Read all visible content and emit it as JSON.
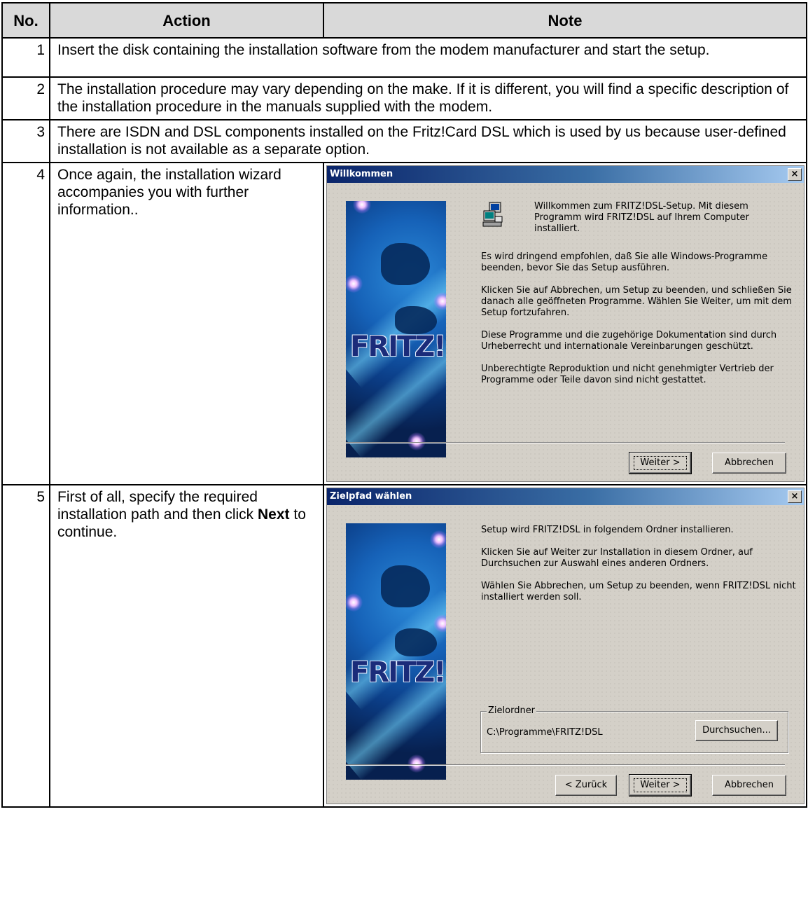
{
  "headers": {
    "no": "No.",
    "action": "Action",
    "note": "Note"
  },
  "rows": [
    {
      "no": "1",
      "text": "Insert the disk containing the installation software from the modem manufacturer and start the setup."
    },
    {
      "no": "2",
      "text": "The installation procedure may vary depending on the make. If it is different, you will find a specific description of the installation procedure in the manuals supplied with the modem."
    },
    {
      "no": "3",
      "text": "There are ISDN and DSL components installed on the Fritz!Card DSL which is used by us because user-defined installation is not available as a separate option."
    },
    {
      "no": "4",
      "text": "Once again, the installation wizard accompanies you with further information.."
    },
    {
      "no": "5",
      "text_before": "First of all, specify the required installation path and then click ",
      "text_bold": "Next",
      "text_after": " to continue."
    }
  ],
  "dialog1": {
    "title": "Willkommen",
    "close_glyph": "×",
    "paragraphs": [
      "Willkommen zum FRITZ!DSL-Setup. Mit diesem Programm wird FRITZ!DSL auf Ihrem Computer installiert.",
      "Es wird dringend empfohlen, daß Sie alle Windows-Programme beenden, bevor Sie das Setup ausführen.",
      "Klicken Sie auf Abbrechen, um Setup zu beenden, und schließen Sie danach alle geöffneten Programme. Wählen Sie Weiter, um mit dem Setup fortzufahren.",
      "Diese Programme und die zugehörige Dokumentation sind durch Urheberrecht und internationale Vereinbarungen geschützt.",
      "Unberechtigte Reproduktion und nicht genehmigter Vertrieb der Programme oder Teile davon sind nicht gestattet."
    ],
    "next_label": "Weiter >",
    "cancel_label": "Abbrechen",
    "logo_text": "FRITZ!"
  },
  "dialog2": {
    "title": "Zielpfad wählen",
    "close_glyph": "×",
    "paragraphs": [
      "Setup wird FRITZ!DSL in folgendem Ordner installieren.",
      "Klicken Sie auf Weiter zur Installation in diesem Ordner, auf Durchsuchen zur Auswahl eines anderen Ordners.",
      "Wählen Sie Abbrechen, um Setup zu beenden, wenn FRITZ!DSL nicht installiert werden soll."
    ],
    "group_label": "Zielordner",
    "path_value": "C:\\Programme\\FRITZ!DSL",
    "browse_label": "Durchsuchen...",
    "back_label": "< Zurück",
    "next_label": "Weiter >",
    "cancel_label": "Abbrechen",
    "logo_text": "FRITZ!"
  }
}
